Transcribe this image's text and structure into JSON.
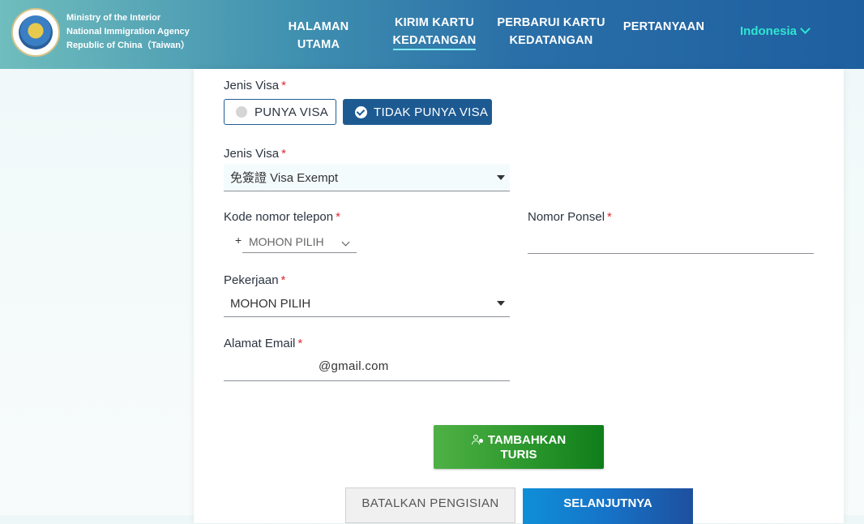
{
  "header": {
    "agency_line1": "Ministry of the Interior",
    "agency_line2": "National Immigration Agency",
    "agency_line3": "Republic of China（Taiwan）",
    "nav": [
      {
        "line1": "HALAMAN UTAMA",
        "line2": ""
      },
      {
        "line1": "KIRIM KARTU",
        "line2": "KEDATANGAN"
      },
      {
        "line1": "PERBARUI KARTU",
        "line2": "KEDATANGAN"
      },
      {
        "line1": "PERTANYAAN",
        "line2": ""
      }
    ],
    "language": "Indonesia",
    "accent_color": "#2fe6d0"
  },
  "form": {
    "visa_type_label": "Jenis Visa",
    "visa_option_have": "PUNYA VISA",
    "visa_option_none": "TIDAK PUNYA VISA",
    "visa_kind_label": "Jenis Visa",
    "visa_kind_value": "免簽證 Visa Exempt",
    "phone_code_label": "Kode nomor telepon",
    "phone_code_prefix": "+",
    "phone_code_value": "MOHON PILIH",
    "mobile_label": "Nomor Ponsel",
    "mobile_value": "",
    "occupation_label": "Pekerjaan",
    "occupation_value": "MOHON PILIH",
    "email_label": "Alamat Email",
    "email_value": "@gmail.com",
    "required_mark": "*"
  },
  "actions": {
    "add_tourist_line1": "TAMBAHKAN",
    "add_tourist_line2": "TURIS",
    "cancel": "BATALKAN PENGISIAN",
    "next": "SELANJUTNYA"
  }
}
